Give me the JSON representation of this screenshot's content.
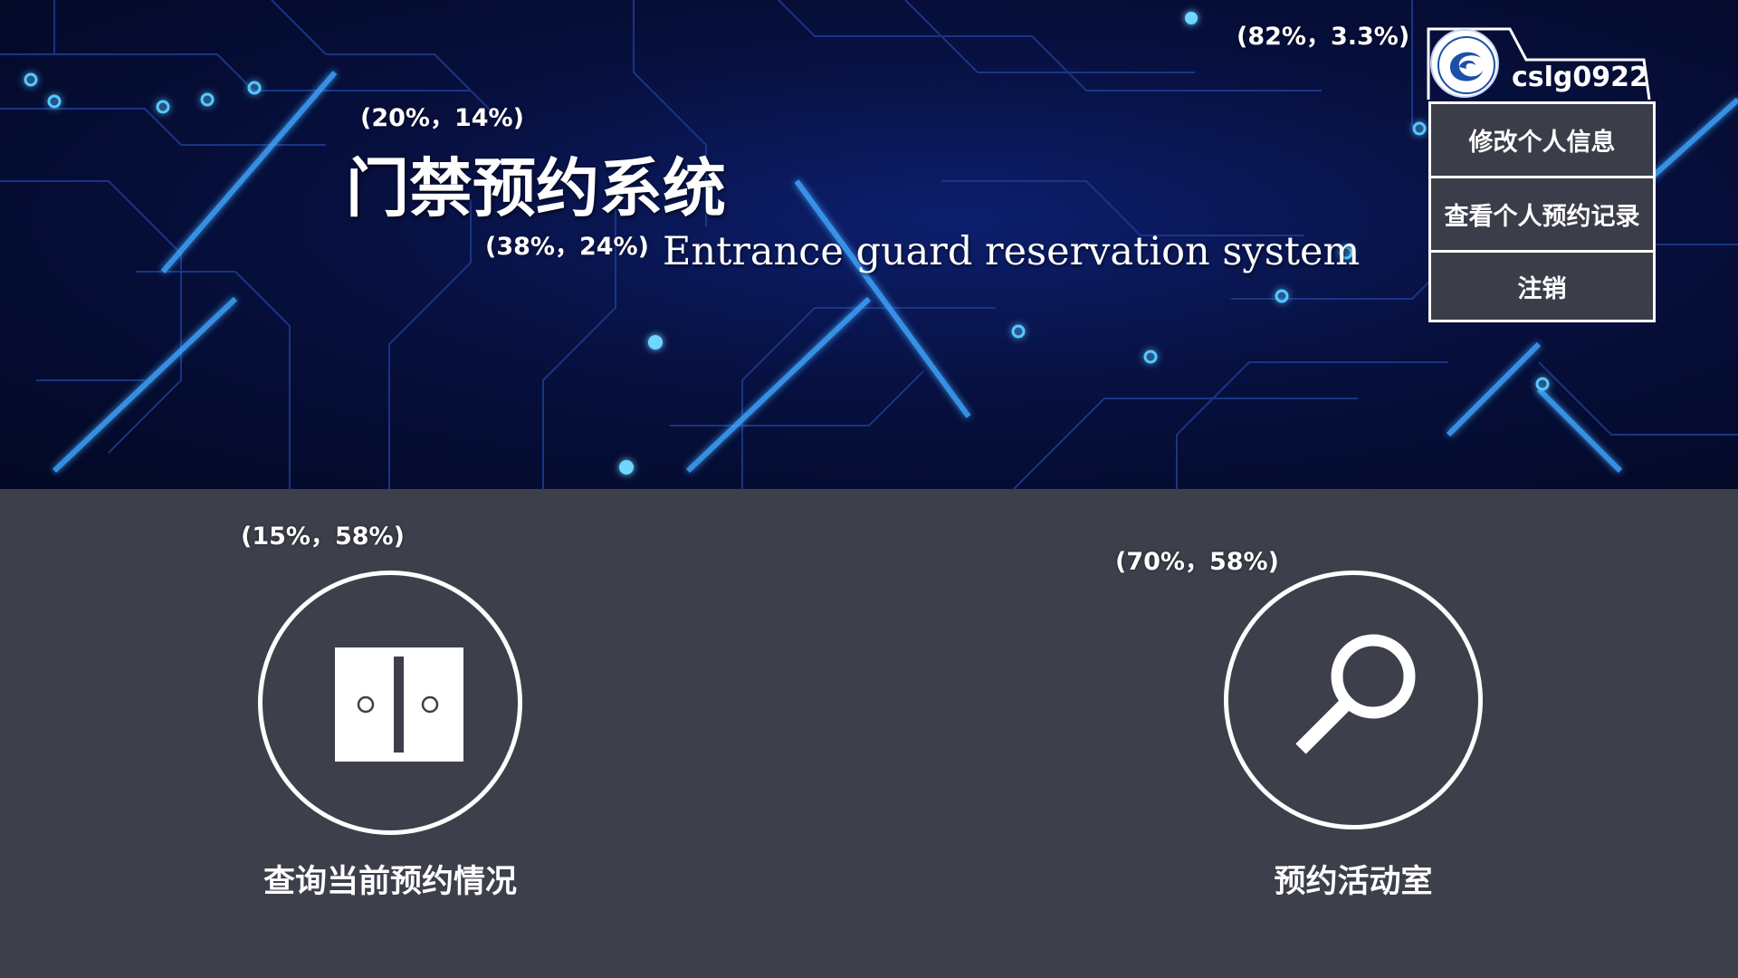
{
  "header": {
    "title_cn": "门禁预约系统",
    "title_en": "Entrance guard reservation system"
  },
  "annotations": {
    "title": "(20%，14%)",
    "subtitle": "(38%，24%)",
    "user": "(82%，3.3%)",
    "left_feature": "(15%，58%)",
    "right_feature": "(70%，58%)"
  },
  "user": {
    "name": "cslg0922",
    "menu": [
      {
        "label": "修改个人信息"
      },
      {
        "label": "查看个人预约记录"
      },
      {
        "label": "注销"
      }
    ]
  },
  "features": {
    "query": {
      "label": "查询当前预约情况",
      "icon": "door-icon"
    },
    "reserve": {
      "label": "预约活动室",
      "icon": "search-icon"
    }
  },
  "colors": {
    "hero_dark": "#030824",
    "hero_mid": "#0d1f6e",
    "glow": "#2e8bff",
    "bottom_bg": "#3d3f4b"
  }
}
